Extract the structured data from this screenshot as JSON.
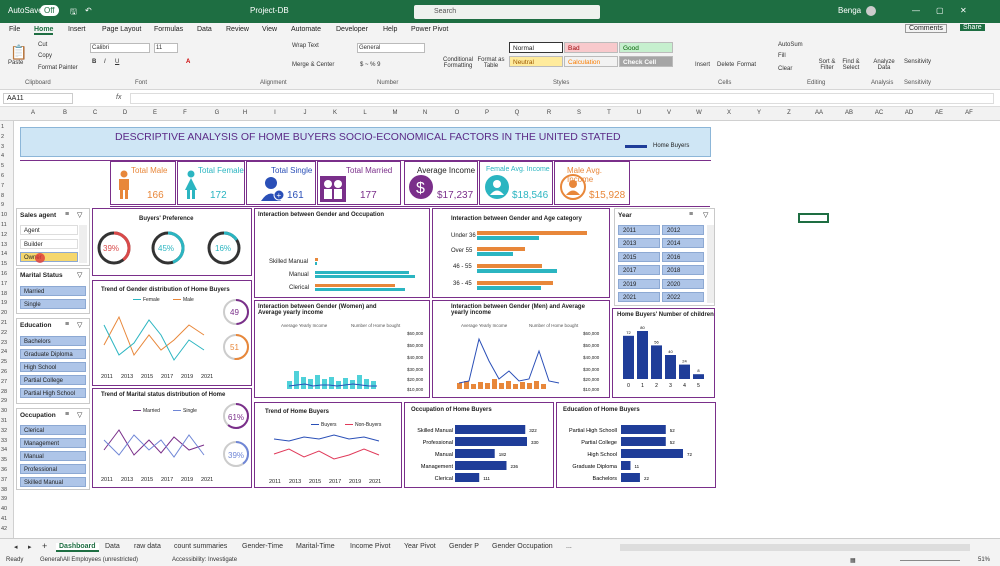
{
  "titlebar": {
    "autosave": "AutoSave",
    "toggle": "Off",
    "filename": "Project-DB",
    "search": "Search",
    "user": "Benga"
  },
  "menu": [
    "File",
    "Home",
    "Insert",
    "Page Layout",
    "Formulas",
    "Data",
    "Review",
    "View",
    "Automate",
    "Developer",
    "Help",
    "Power Pivot"
  ],
  "comments": "Comments",
  "share": "Share",
  "ribbon": {
    "paste": "Paste",
    "cut": "Cut",
    "copy": "Copy",
    "format_painter": "Format Painter",
    "clipboard": "Clipboard",
    "font_name": "Calibri",
    "font_size": "11",
    "font": "Font",
    "wrap": "Wrap Text",
    "merge": "Merge & Center",
    "alignment": "Alignment",
    "number_format": "General",
    "number": "Number",
    "cond": "Conditional Formatting",
    "fmt_table": "Format as Table",
    "styles": [
      "Normal",
      "Bad",
      "Good",
      "Neutral",
      "Calculation",
      "Check Cell"
    ],
    "styles_label": "Styles",
    "insert": "Insert",
    "delete": "Delete",
    "format": "Format",
    "cells": "Cells",
    "autosum": "AutoSum",
    "fill": "Fill",
    "clear": "Clear",
    "sort": "Sort & Filter",
    "find": "Find & Select",
    "editing": "Editing",
    "analyze": "Analyze Data",
    "analysis": "Analysis",
    "sensitivity": "Sensitivity"
  },
  "formula_bar": {
    "name_box": "AA11",
    "fx": "fx"
  },
  "columns": [
    "A",
    "B",
    "C",
    "D",
    "E",
    "F",
    "G",
    "H",
    "I",
    "J",
    "K",
    "L",
    "M",
    "N",
    "O",
    "P",
    "Q",
    "R",
    "S",
    "T",
    "U",
    "V",
    "W",
    "X",
    "Y",
    "Z",
    "AA",
    "AB",
    "AC",
    "AD",
    "AE",
    "AF"
  ],
  "rows": [
    "1",
    "2",
    "3",
    "4",
    "5",
    "6",
    "7",
    "8",
    "9",
    "10",
    "11",
    "12",
    "13",
    "14",
    "15",
    "16",
    "17",
    "18",
    "19",
    "20",
    "21",
    "22",
    "23",
    "24",
    "25",
    "26",
    "27",
    "28",
    "29",
    "30",
    "31",
    "32",
    "33",
    "34",
    "35",
    "36",
    "37",
    "38",
    "39",
    "40",
    "41",
    "42"
  ],
  "dashboard": {
    "title": "DESCRIPTIVE ANALYSIS OF HOME BUYERS SOCIO-ECONOMICAL FACTORS IN THE UNITED STATED",
    "legend": "Home Buyers",
    "kpis": [
      {
        "label": "Total Male",
        "value": "166",
        "color": "#e8873a"
      },
      {
        "label": "Total Female",
        "value": "172",
        "color": "#2bb5c1"
      },
      {
        "label": "Total Single",
        "value": "161",
        "color": "#2a4fb7"
      },
      {
        "label": "Total Married",
        "value": "177",
        "color": "#7a2f8a"
      },
      {
        "label": "Average Income",
        "value": "$17,237",
        "color": "#7a2f8a"
      },
      {
        "label": "Female Avg. Income",
        "value": "$18,546",
        "color": "#2bb5c1"
      },
      {
        "label": "Male Avg. Income",
        "value": "$15,928",
        "color": "#e8873a"
      }
    ]
  },
  "slicers": {
    "sales_agent": {
      "title": "Sales agent",
      "items": [
        "Agent",
        "Builder",
        "Owner"
      ]
    },
    "marital": {
      "title": "Marital Status",
      "items": [
        "Married",
        "Single"
      ]
    },
    "education": {
      "title": "Education",
      "items": [
        "Bachelors",
        "Graduate Diploma",
        "High School",
        "Partial College",
        "Partial High School"
      ]
    },
    "occupation": {
      "title": "Occupation",
      "items": [
        "Clerical",
        "Management",
        "Manual",
        "Professional",
        "Skilled Manual"
      ]
    },
    "year": {
      "title": "Year",
      "items": [
        "2011",
        "2012",
        "2013",
        "2014",
        "2015",
        "2016",
        "2017",
        "2018",
        "2019",
        "2020",
        "2021",
        "2022"
      ]
    }
  },
  "charts": {
    "preference": {
      "title": "Buyers' Preference",
      "values": [
        "39%",
        "45%",
        "16%"
      ],
      "colors": [
        "#d94a4a",
        "#2bb5c1",
        "#2bb5c1"
      ]
    },
    "gender_occ": {
      "title": "Interaction between Gender and Occupation",
      "cats": [
        "Skilled Manual",
        "Manual",
        "Clerical"
      ]
    },
    "gender_age": {
      "title": "Interaction between Gender and Age category",
      "cats": [
        "Under 36",
        "Over 55",
        "46 - 55",
        "36 - 45"
      ]
    },
    "trend_gender": {
      "title": "Trend of Gender distribution of Home Buyers",
      "legend": [
        "Female",
        "Male"
      ],
      "years": [
        "2011",
        "2013",
        "2015",
        "2017",
        "2019",
        "2021"
      ],
      "rings": [
        "49",
        "51"
      ]
    },
    "women_income": {
      "title": "Interaction between Gender (Women) and Average yearly income",
      "legend": [
        "Average Yearly Income",
        "Number of Home bought"
      ],
      "y": [
        "70",
        "60",
        "50",
        "40",
        "30",
        "20",
        "10",
        "0"
      ],
      "y2": [
        "$60,000",
        "$50,000",
        "$40,000",
        "$30,000",
        "$20,000",
        "$10,000"
      ]
    },
    "men_income": {
      "title": "Interaction between Gender (Men) and Average yearly income",
      "legend": [
        "Average Yearly Income",
        "Number of Home bought"
      ],
      "y2": [
        "$60,000",
        "$50,000",
        "$40,000",
        "$30,000",
        "$20,000",
        "$10,000"
      ]
    },
    "children": {
      "title": "Home Buyers' Number of children",
      "cats": [
        "0",
        "1",
        "2",
        "3",
        "4",
        "5"
      ],
      "labels": [
        "72",
        "80",
        "56",
        "40",
        "24",
        "8"
      ]
    },
    "trend_marital": {
      "title": "Trend of Marital status distribution of Home",
      "legend": [
        "Married",
        "Single"
      ],
      "years": [
        "2011",
        "2013",
        "2015",
        "2017",
        "2019",
        "2021"
      ],
      "rings": [
        "61%",
        "39%"
      ]
    },
    "trend_buyers": {
      "title": "Trend of Home Buyers",
      "legend": [
        "Buyers",
        "Non-Buyers"
      ],
      "years": [
        "2011",
        "2013",
        "2015",
        "2017",
        "2019",
        "2021"
      ]
    },
    "occupation": {
      "title": "Occupation of Home Buyers",
      "cats": [
        "Skilled Manual",
        "Professional",
        "Manual",
        "Management",
        "Clerical"
      ],
      "values": [
        "322",
        "330",
        "182",
        "236",
        "111"
      ]
    },
    "education": {
      "title": "Education of Home Buyers",
      "cats": [
        "Partial High Schooll",
        "Partial College",
        "High School",
        "Graduate Diploma",
        "Bachelors"
      ],
      "values": [
        "52",
        "52",
        "72",
        "11",
        "22"
      ]
    }
  },
  "chart_data": [
    {
      "type": "bar",
      "title": "Occupation of Home Buyers",
      "categories": [
        "Skilled Manual",
        "Professional",
        "Manual",
        "Management",
        "Clerical"
      ],
      "values": [
        322,
        330,
        182,
        236,
        111
      ]
    },
    {
      "type": "bar",
      "title": "Education of Home Buyers",
      "categories": [
        "Partial High Schooll",
        "Partial College",
        "High School",
        "Graduate Diploma",
        "Bachelors"
      ],
      "values": [
        52,
        52,
        72,
        11,
        22
      ]
    },
    {
      "type": "bar",
      "title": "Home Buyers' Number of children",
      "categories": [
        "0",
        "1",
        "2",
        "3",
        "4",
        "5"
      ],
      "values": [
        72,
        80,
        56,
        40,
        24,
        8
      ]
    }
  ],
  "sheet_tabs": [
    "Dashboard",
    "Data",
    "raw data",
    "count summaries",
    "Gender-Time",
    "Marital-Time",
    "Income Pivot",
    "Year Pivot",
    "Gender P",
    "Gender Occupation",
    "..."
  ],
  "status": {
    "ready": "Ready",
    "label": "General\\All Employees (unrestricted)",
    "access": "Accessibility: Investigate",
    "zoom": "51%"
  }
}
